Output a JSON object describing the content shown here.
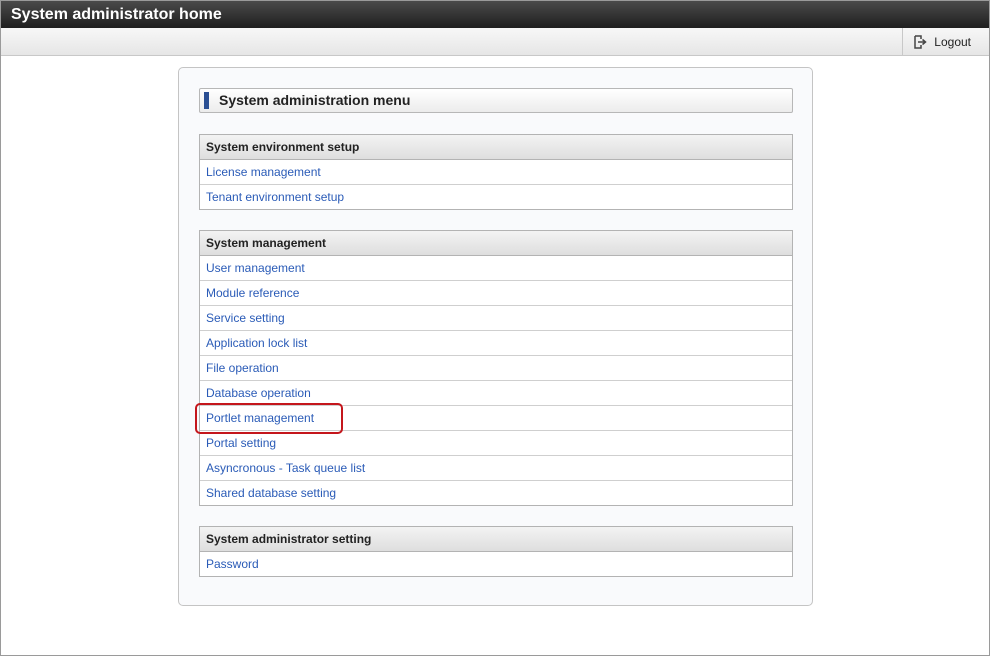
{
  "window": {
    "title": "System administrator home"
  },
  "toolbar": {
    "logout_label": "Logout",
    "logout_icon": "logout-icon"
  },
  "menu": {
    "title": "System administration menu"
  },
  "sections": [
    {
      "title": "System environment setup",
      "items": [
        "License management",
        "Tenant environment setup"
      ]
    },
    {
      "title": "System management",
      "items": [
        "User management",
        "Module reference",
        "Service setting",
        "Application lock list",
        "File operation",
        "Database operation",
        "Portlet management",
        "Portal setting",
        "Asyncronous - Task queue list",
        "Shared database setting"
      ]
    },
    {
      "title": "System administrator setting",
      "items": [
        "Password"
      ]
    }
  ],
  "highlighted_item": "Portlet management",
  "colors": {
    "link": "#2a5bb7",
    "accent": "#2b4f93",
    "highlight": "#c4161c"
  }
}
